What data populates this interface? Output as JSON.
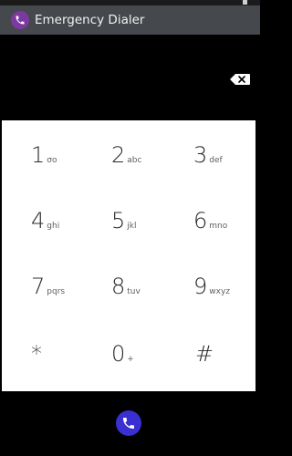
{
  "app": {
    "title": "Emergency Dialer"
  },
  "display": {
    "digits": ""
  },
  "keypad": {
    "keys": [
      {
        "num": "1",
        "sub": "σο"
      },
      {
        "num": "2",
        "sub": "abc"
      },
      {
        "num": "3",
        "sub": "def"
      },
      {
        "num": "4",
        "sub": "ghi"
      },
      {
        "num": "5",
        "sub": "jkl"
      },
      {
        "num": "6",
        "sub": "mno"
      },
      {
        "num": "7",
        "sub": "pqrs"
      },
      {
        "num": "8",
        "sub": "tuv"
      },
      {
        "num": "9",
        "sub": "wxyz"
      },
      {
        "num": "*",
        "sub": ""
      },
      {
        "num": "0",
        "sub": "+"
      },
      {
        "num": "#",
        "sub": ""
      }
    ]
  },
  "colors": {
    "titlebar": "#45484c",
    "app_icon": "#7c3aa1",
    "call_button": "#3a2fd0",
    "keypad_bg": "#ffffff"
  },
  "icons": {
    "app": "phone-icon",
    "backspace": "backspace-icon",
    "call": "phone-icon"
  }
}
